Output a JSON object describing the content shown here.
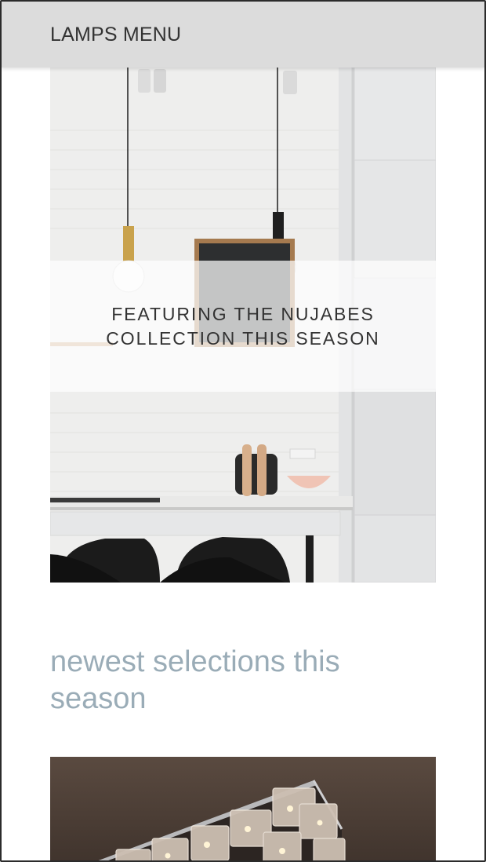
{
  "header": {
    "menu_label": "LAMPS MENU"
  },
  "hero": {
    "caption_line1": "FEATURING THE NUJABES",
    "caption_line2": "COLLECTION THIS SEASON",
    "image_icon": "kitchen-pendant-lamps-photo"
  },
  "section": {
    "title": "newest selections this season"
  },
  "product": {
    "image_icon": "crystal-chandelier-photo"
  },
  "colors": {
    "header_bg": "#dcdcdc",
    "heading_accent": "#9aacb7",
    "text_dark": "#333333"
  }
}
